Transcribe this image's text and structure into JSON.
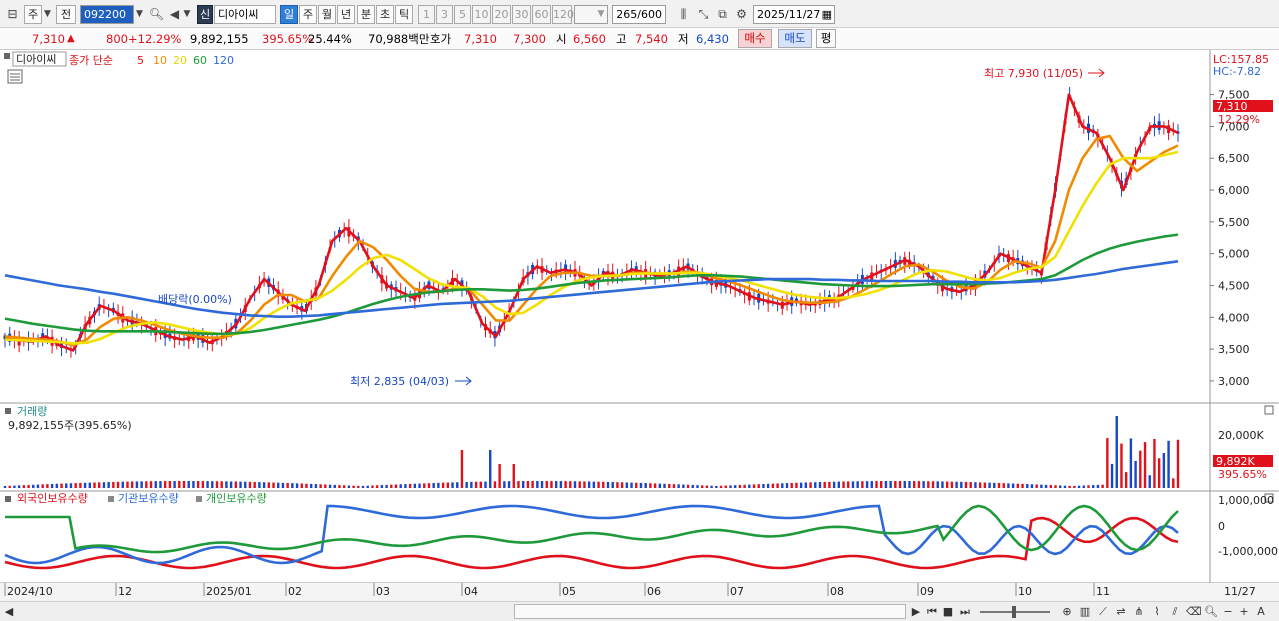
{
  "toolbar": {
    "market": "주",
    "prev": "전",
    "code": "092200",
    "new_badge": "신",
    "stock_name": "디아이씨",
    "periods": [
      "일",
      "주",
      "월",
      "년",
      "분",
      "초",
      "틱"
    ],
    "active_period": "일",
    "intervals": [
      "1",
      "3",
      "5",
      "10",
      "20",
      "30",
      "60",
      "120"
    ],
    "count": "265",
    "count_max": "/600",
    "date": "2025/11/27"
  },
  "quote": {
    "price": "7,310",
    "change_arrow": "▲",
    "change": "800",
    "change_pct": "+12.29%",
    "volume": "9,892,155",
    "volume_pct": "395.65%",
    "turnover": "25.44%",
    "amount": "70,988백만",
    "bid_label": "호가",
    "bid1": "7,310",
    "bid2": "7,300",
    "open_label": "시",
    "open": "6,560",
    "high_label": "고",
    "high": "7,540",
    "low_label": "저",
    "low": "6,430",
    "buy": "매수",
    "sell": "매도",
    "avg": "평"
  },
  "main_panel": {
    "title": "디아이씨",
    "ma_label": "종가 단순",
    "ma_periods": [
      {
        "label": "5",
        "color": "#e0111b"
      },
      {
        "label": "10",
        "color": "#f08a00"
      },
      {
        "label": "20",
        "color": "#f2e000"
      },
      {
        "label": "60",
        "color": "#1f9a3a"
      },
      {
        "label": "120",
        "color": "#2f6ad9"
      }
    ],
    "lc": "LC:157.85",
    "hc": "HC:-7.82",
    "price_box": "7,310",
    "price_pct": "12.29%",
    "high_note": "최고 7,930 (11/05)",
    "low_note": "최저 2,835 (04/03)",
    "dividend_note": "배당락(0.00%)",
    "y_ticks": [
      "7,500",
      "7,000",
      "6,500",
      "6,000",
      "5,500",
      "5,000",
      "4,500",
      "4,000",
      "3,500",
      "3,000"
    ]
  },
  "volume_panel": {
    "title": "거래량",
    "value_line": "9,892,155주(395.65%)",
    "tick": "20,000K",
    "box": "9,892K",
    "box_pct": "395.65%"
  },
  "holdings_panel": {
    "legend": [
      {
        "label": "외국인보유수량",
        "color": "#e0111b"
      },
      {
        "label": "기관보유수량",
        "color": "#2f6ad9"
      },
      {
        "label": "개인보유수량",
        "color": "#1f9a3a"
      }
    ],
    "ticks": [
      "1,000,000",
      "0",
      "-1,000,000"
    ]
  },
  "x_axis": [
    "2024/10",
    "12",
    "2025/01",
    "02",
    "03",
    "04",
    "05",
    "06",
    "07",
    "08",
    "09",
    "10",
    "11",
    "11/27"
  ],
  "chart_data": {
    "type": "line",
    "title": "디아이씨",
    "ylim": [
      2700,
      7950
    ],
    "annotations": {
      "high": 7930,
      "high_date": "11/05",
      "low": 2835,
      "low_date": "04/03"
    },
    "series": [
      {
        "name": "5",
        "color": "#e0111b",
        "values": [
          3680,
          3640,
          3620,
          3700,
          3560,
          3480,
          3900,
          4180,
          4100,
          3950,
          3900,
          3800,
          3700,
          3650,
          3700,
          3600,
          3700,
          3900,
          4300,
          4600,
          4400,
          4200,
          4100,
          4500,
          5200,
          5400,
          5200,
          4800,
          4500,
          4400,
          4300,
          4500,
          4400,
          4600,
          4400,
          3900,
          3700,
          4100,
          4600,
          4800,
          4700,
          4750,
          4700,
          4500,
          4700,
          4650,
          4750,
          4700,
          4650,
          4700,
          4800,
          4650,
          4550,
          4500,
          4400,
          4300,
          4250,
          4200,
          4250,
          4200,
          4250,
          4300,
          4450,
          4600,
          4700,
          4800,
          4900,
          4800,
          4600,
          4450,
          4400,
          4500,
          4700,
          5000,
          4900,
          4800,
          4700,
          6000,
          7500,
          7000,
          6900,
          6500,
          6000,
          6600,
          7000,
          7000,
          6900
        ]
      },
      {
        "name": "10",
        "color": "#f08a00",
        "values": [
          3700,
          3680,
          3660,
          3650,
          3620,
          3560,
          3650,
          3850,
          3980,
          4000,
          3950,
          3880,
          3800,
          3740,
          3700,
          3680,
          3680,
          3750,
          3950,
          4200,
          4350,
          4350,
          4250,
          4300,
          4650,
          4950,
          5200,
          5100,
          4900,
          4650,
          4450,
          4400,
          4400,
          4450,
          4450,
          4200,
          3950,
          3950,
          4200,
          4450,
          4650,
          4700,
          4700,
          4650,
          4650,
          4650,
          4700,
          4700,
          4680,
          4680,
          4720,
          4700,
          4620,
          4570,
          4500,
          4420,
          4340,
          4270,
          4240,
          4230,
          4230,
          4250,
          4320,
          4430,
          4550,
          4680,
          4800,
          4830,
          4720,
          4580,
          4480,
          4450,
          4550,
          4750,
          4880,
          4850,
          4780,
          5200,
          6000,
          6500,
          6800,
          6850,
          6500,
          6300,
          6450,
          6600,
          6700
        ]
      },
      {
        "name": "20",
        "color": "#f2e000",
        "values": [
          3650,
          3640,
          3630,
          3620,
          3610,
          3590,
          3600,
          3660,
          3760,
          3850,
          3900,
          3920,
          3890,
          3840,
          3790,
          3760,
          3730,
          3740,
          3830,
          3990,
          4120,
          4220,
          4260,
          4300,
          4420,
          4590,
          4780,
          4930,
          4980,
          4900,
          4760,
          4620,
          4520,
          4480,
          4460,
          4330,
          4150,
          4050,
          4070,
          4200,
          4350,
          4480,
          4580,
          4630,
          4650,
          4660,
          4680,
          4690,
          4690,
          4690,
          4700,
          4700,
          4660,
          4620,
          4580,
          4520,
          4460,
          4400,
          4350,
          4320,
          4300,
          4300,
          4320,
          4360,
          4420,
          4500,
          4600,
          4700,
          4740,
          4720,
          4660,
          4600,
          4580,
          4620,
          4700,
          4760,
          4790,
          4950,
          5350,
          5750,
          6100,
          6400,
          6500,
          6500,
          6500,
          6550,
          6600
        ]
      },
      {
        "name": "60",
        "color": "#1f9a3a",
        "values": [
          3980,
          3940,
          3900,
          3870,
          3840,
          3810,
          3790,
          3780,
          3780,
          3780,
          3780,
          3780,
          3770,
          3760,
          3750,
          3740,
          3740,
          3750,
          3770,
          3800,
          3840,
          3880,
          3920,
          3960,
          4010,
          4070,
          4140,
          4210,
          4270,
          4320,
          4360,
          4390,
          4410,
          4430,
          4440,
          4440,
          4430,
          4420,
          4430,
          4450,
          4480,
          4510,
          4540,
          4560,
          4580,
          4590,
          4600,
          4610,
          4620,
          4630,
          4650,
          4660,
          4660,
          4650,
          4640,
          4620,
          4600,
          4580,
          4560,
          4540,
          4520,
          4510,
          4500,
          4490,
          4490,
          4490,
          4500,
          4510,
          4520,
          4520,
          4520,
          4520,
          4530,
          4540,
          4560,
          4580,
          4600,
          4660,
          4780,
          4900,
          5000,
          5080,
          5140,
          5190,
          5230,
          5270,
          5300
        ]
      },
      {
        "name": "120",
        "color": "#2f6ad9",
        "values": [
          4660,
          4620,
          4580,
          4540,
          4500,
          4470,
          4440,
          4400,
          4370,
          4330,
          4290,
          4250,
          4210,
          4170,
          4130,
          4100,
          4070,
          4050,
          4030,
          4020,
          4010,
          4010,
          4020,
          4030,
          4050,
          4070,
          4090,
          4110,
          4130,
          4150,
          4170,
          4190,
          4210,
          4220,
          4230,
          4240,
          4250,
          4260,
          4280,
          4300,
          4320,
          4340,
          4360,
          4380,
          4400,
          4420,
          4440,
          4460,
          4480,
          4500,
          4520,
          4540,
          4560,
          4570,
          4580,
          4590,
          4600,
          4600,
          4600,
          4600,
          4590,
          4590,
          4580,
          4580,
          4570,
          4570,
          4570,
          4570,
          4570,
          4560,
          4560,
          4550,
          4550,
          4550,
          4550,
          4560,
          4570,
          4590,
          4620,
          4650,
          4680,
          4720,
          4760,
          4790,
          4820,
          4850,
          4880
        ]
      }
    ]
  }
}
